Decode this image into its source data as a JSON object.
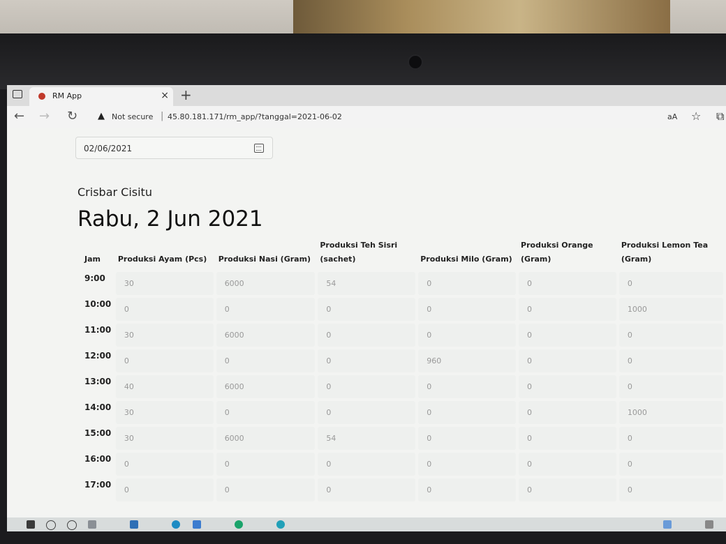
{
  "browser": {
    "tab_title": "RM App",
    "security_label": "Not secure",
    "url": "45.80.181.171/rm_app/?tanggal=2021-06-02",
    "reader_label": "aA"
  },
  "page": {
    "date_value": "02/06/2021",
    "location": "Crisbar Cisitu",
    "heading": "Rabu, 2 Jun 2021"
  },
  "table": {
    "headers": [
      "Jam",
      "Produksi Ayam (Pcs)",
      "Produksi Nasi (Gram)",
      "Produksi Teh Sisri (sachet)",
      "Produksi Milo (Gram)",
      "Produksi Orange (Gram)",
      "Produksi Lemon Tea (Gram)"
    ],
    "rows": [
      {
        "jam": "9:00",
        "values": [
          "30",
          "6000",
          "54",
          "0",
          "0",
          "0"
        ]
      },
      {
        "jam": "10:00",
        "values": [
          "0",
          "0",
          "0",
          "0",
          "0",
          "1000"
        ]
      },
      {
        "jam": "11:00",
        "values": [
          "30",
          "6000",
          "0",
          "0",
          "0",
          "0"
        ]
      },
      {
        "jam": "12:00",
        "values": [
          "0",
          "0",
          "0",
          "960",
          "0",
          "0"
        ]
      },
      {
        "jam": "13:00",
        "values": [
          "40",
          "6000",
          "0",
          "0",
          "0",
          "0"
        ]
      },
      {
        "jam": "14:00",
        "values": [
          "30",
          "0",
          "0",
          "0",
          "0",
          "1000"
        ]
      },
      {
        "jam": "15:00",
        "values": [
          "30",
          "6000",
          "54",
          "0",
          "0",
          "0"
        ]
      },
      {
        "jam": "16:00",
        "values": [
          "0",
          "0",
          "0",
          "0",
          "0",
          "0"
        ]
      },
      {
        "jam": "17:00",
        "values": [
          "0",
          "0",
          "0",
          "0",
          "0",
          "0"
        ]
      }
    ]
  }
}
